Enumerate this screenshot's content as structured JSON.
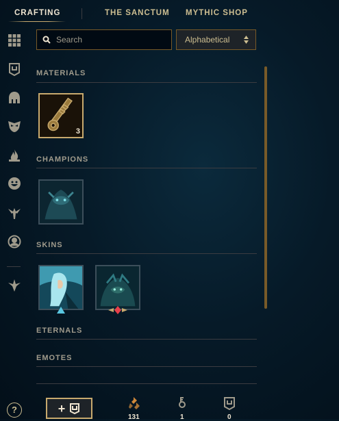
{
  "tabs": [
    {
      "label": "CRAFTING",
      "active": true
    },
    {
      "label": "THE SANCTUM",
      "active": false
    },
    {
      "label": "MYTHIC SHOP",
      "active": false
    }
  ],
  "search": {
    "placeholder": "Search",
    "value": ""
  },
  "sort": {
    "label": "Alphabetical"
  },
  "sections": {
    "materials": {
      "title": "MATERIALS",
      "items": [
        {
          "name": "hextech-key",
          "count": "3"
        }
      ]
    },
    "champions": {
      "title": "CHAMPIONS"
    },
    "skins": {
      "title": "SKINS"
    },
    "eternals": {
      "title": "ETERNALS"
    },
    "emotes": {
      "title": "EMOTES"
    }
  },
  "rail_icons": [
    "grid-icon",
    "chest-icon",
    "champion-helmet-icon",
    "skin-mask-icon",
    "ward-flame-icon",
    "emote-face-icon",
    "summoner-icon-icon",
    "profile-icon",
    "eternals-icon"
  ],
  "bottom": {
    "help_label": "?",
    "add_button_label": "+",
    "currencies": [
      {
        "icon": "orange-essence-icon",
        "value": "131"
      },
      {
        "icon": "key-fragment-icon",
        "value": "1"
      },
      {
        "icon": "chest-icon",
        "value": "0"
      }
    ]
  },
  "colors": {
    "gold": "#c8aa6e",
    "gold_light": "#f0e6d2",
    "background": "#061a28",
    "border": "#785a28"
  }
}
